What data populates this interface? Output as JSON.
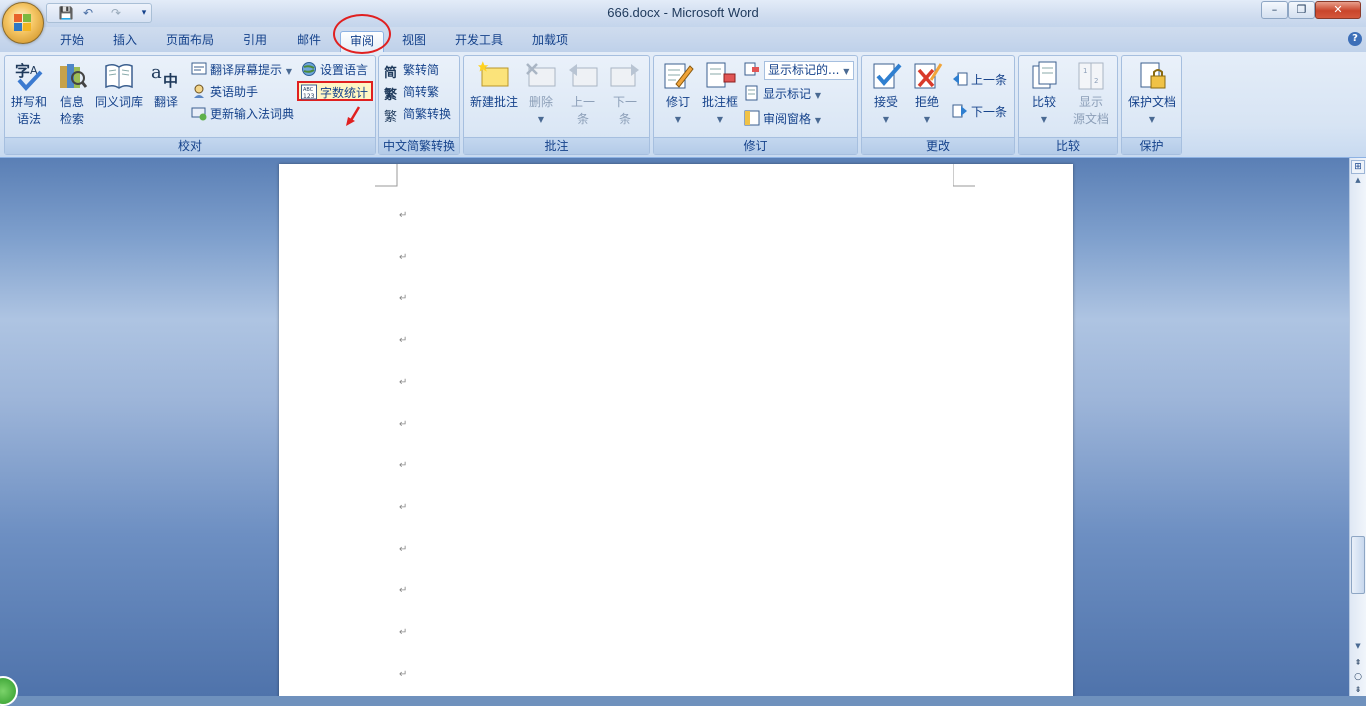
{
  "window": {
    "title": "666.docx - Microsoft Word",
    "minimize": "–",
    "maximize": "❐",
    "close": "✕"
  },
  "qat": {
    "save": "💾",
    "undo": "↶",
    "redo": "↷",
    "customize": "▾"
  },
  "tabs": [
    {
      "label": "开始"
    },
    {
      "label": "插入"
    },
    {
      "label": "页面布局"
    },
    {
      "label": "引用"
    },
    {
      "label": "邮件"
    },
    {
      "label": "审阅",
      "active": true
    },
    {
      "label": "视图"
    },
    {
      "label": "开发工具"
    },
    {
      "label": "加载项"
    }
  ],
  "help": "?",
  "ribbon": {
    "proofing": {
      "label": "校对",
      "spelling": "拼写和\n语法",
      "spelling_l1": "拼写和",
      "spelling_l2": "语法",
      "research_l1": "信息",
      "research_l2": "检索",
      "thesaurus": "同义词库",
      "translate": "翻译",
      "translate_tip": "翻译屏幕提示",
      "english_assistant": "英语助手",
      "update_ime": "更新输入法词典",
      "set_language": "设置语言",
      "word_count": "字数统计"
    },
    "chinese": {
      "label": "中文简繁转换",
      "trad_to_simp": "繁转简",
      "simp_to_trad": "简转繁",
      "convert": "简繁转换",
      "icon_simp": "简",
      "icon_trad": "繁",
      "icon_conv": "繁"
    },
    "comments": {
      "label": "批注",
      "new": "新建批注",
      "delete": "删除",
      "prev_l1": "上一",
      "prev_l2": "条",
      "next_l1": "下一",
      "next_l2": "条"
    },
    "tracking": {
      "label": "修订",
      "track": "修订",
      "balloons": "批注框",
      "display_markup": "显示标记的...",
      "show_markup": "显示标记",
      "review_pane": "审阅窗格"
    },
    "changes": {
      "label": "更改",
      "accept": "接受",
      "reject": "拒绝",
      "previous": "上一条",
      "next": "下一条"
    },
    "compare": {
      "label": "比较",
      "compare": "比较",
      "show_source_l1": "显示",
      "show_source_l2": "源文档"
    },
    "protect": {
      "label": "保护",
      "protect_doc": "保护文档"
    }
  },
  "document": {
    "paragraph_mark": "↵",
    "paragraph_count": 12
  },
  "colors": {
    "annotation_red": "#e02020",
    "ribbon_text": "#15428b",
    "page": "#ffffff"
  }
}
